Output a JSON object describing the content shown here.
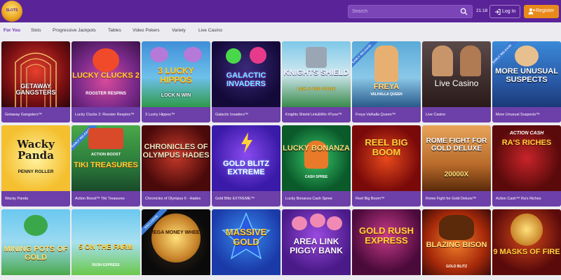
{
  "brand": {
    "logo_text": "SLOTS"
  },
  "search": {
    "placeholder": "Search"
  },
  "clock": "21:18",
  "login_label": "Log In",
  "register_label": "Register",
  "tabs": [
    {
      "label": "For You",
      "active": true
    },
    {
      "label": "Slots"
    },
    {
      "label": "Progressive Jackpots"
    },
    {
      "label": "Tables"
    },
    {
      "label": "Video Pokers"
    },
    {
      "label": "Variety"
    },
    {
      "label": "Live Casino"
    }
  ],
  "badges": {
    "early_release": "EARLY RELEASE",
    "exclusive": "EXCLUSIVE"
  },
  "games": [
    {
      "art_title": "GETAWAY GANGSTERS",
      "caption": "Getaway Gangsters™"
    },
    {
      "art_title": "LUCKY CLUCKS 2",
      "art_sub": "ROOSTER RESPINS",
      "caption": "Lucky Clucks 2: Rooster Respins™"
    },
    {
      "art_title": "3 LUCKY HIPPOS",
      "art_sub": "LOCK N WIN",
      "caption": "3 Lucky Hippos™"
    },
    {
      "art_title": "GALACTIC INVADERS",
      "caption": "Galactic Invaders™"
    },
    {
      "art_title": "KNIGHTS SHIELD",
      "art_sub": "LINK & WIN 4TUNE",
      "caption": "Knights Shield Link&Win 4Tune™"
    },
    {
      "art_title": "FREYA",
      "art_sub": "VALHALLA QUEEN",
      "caption": "Freya Valhalla Queen™"
    },
    {
      "art_title": "Live Casino",
      "caption": "Live Casino"
    },
    {
      "art_title": "MORE UNUSUAL SUSPECTS",
      "caption": "More Unusual Suspects™"
    },
    {
      "art_title": "Wacky Panda",
      "art_sub": "PENNY ROLLER",
      "caption": "Wacky Panda"
    },
    {
      "art_title": "TIKI TREASURES",
      "art_sub": "ACTION BOOST",
      "caption": "Action Boost™ Tiki Treasures"
    },
    {
      "art_title": "CHRONICLES OF OLYMPUS HADES",
      "caption": "Chronicles of Olympus II - Hades"
    },
    {
      "art_title": "GOLD BLITZ EXTREME",
      "caption": "Gold Blitz EXTREME™"
    },
    {
      "art_title": "LUCKY BONANZA",
      "art_sub": "CASH SPREE",
      "caption": "Lucky Bonanza Cash Spree"
    },
    {
      "art_title": "REEL BIG BOOM",
      "caption": "Reel Big Boom™"
    },
    {
      "art_title": "ROME FIGHT FOR GOLD DELUXE",
      "art_sub": "20000X",
      "caption": "Rome Fight for Gold Deluxe™"
    },
    {
      "art_title": "RA'S RICHES",
      "art_sub": "ACTION CASH",
      "caption": "Action Cash™ Ra's Riches"
    },
    {
      "art_title": "MINING POTS OF GOLD",
      "caption": ""
    },
    {
      "art_title": "5 ON THE FARM",
      "art_sub": "RUSH EXPRESS",
      "caption": ""
    },
    {
      "art_title": "MEGA MONEY WHEEL",
      "caption": ""
    },
    {
      "art_title": "MASSIVE GOLD",
      "caption": ""
    },
    {
      "art_title": "AREA LINK PIGGY BANK",
      "caption": ""
    },
    {
      "art_title": "GOLD RUSH EXPRESS",
      "caption": ""
    },
    {
      "art_title": "BLAZING BISON",
      "art_sub": "GOLD BLITZ",
      "caption": ""
    },
    {
      "art_title": "9 MASKS OF FIRE",
      "caption": ""
    }
  ],
  "colors": {
    "header": "#5b2398",
    "accent": "#e88a1b",
    "caption_bg": "#6d3fa8",
    "active_tab": "#6a2fb0"
  }
}
